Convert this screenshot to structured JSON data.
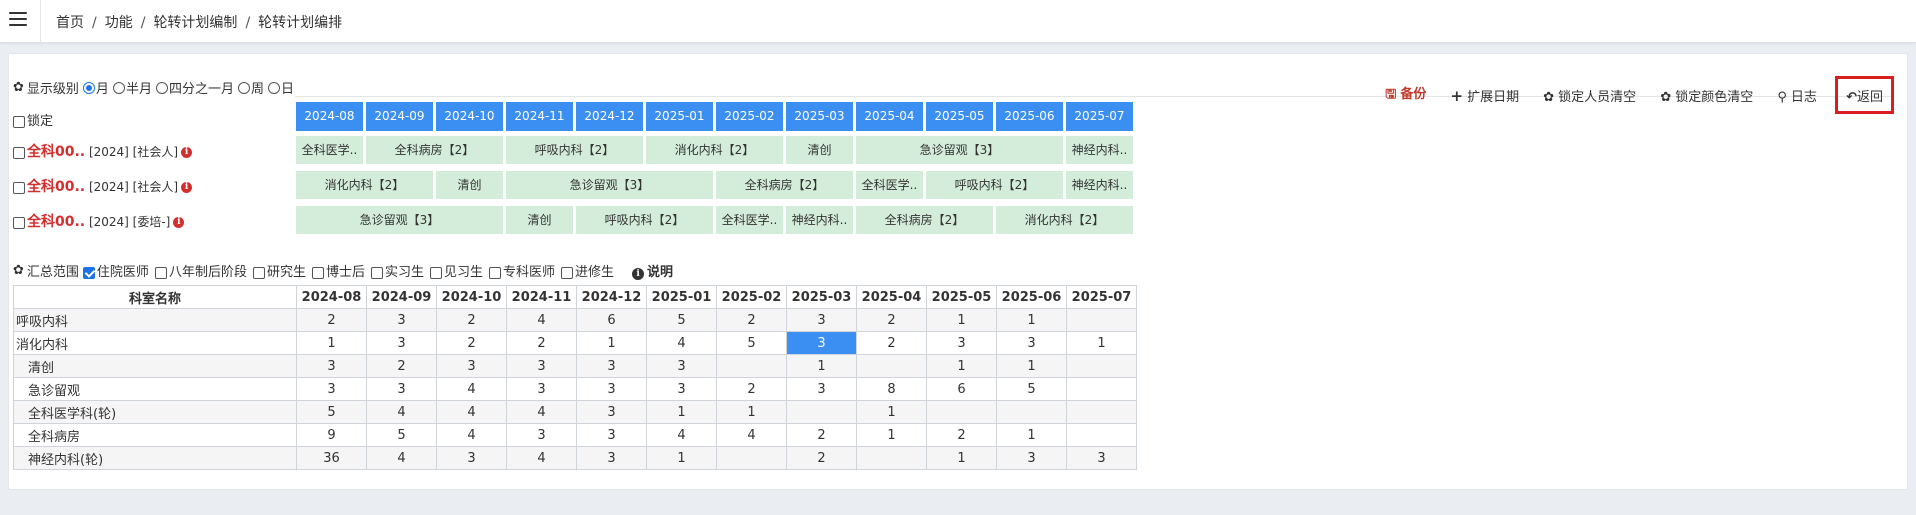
{
  "breadcrumb": [
    "首页",
    "功能",
    "轮转计划编制",
    "轮转计划编排"
  ],
  "display": {
    "label": "显示级别",
    "options": [
      {
        "label": "月",
        "checked": true
      },
      {
        "label": "半月",
        "checked": false
      },
      {
        "label": "四分之一月",
        "checked": false
      },
      {
        "label": "周",
        "checked": false
      },
      {
        "label": "日",
        "checked": false
      }
    ]
  },
  "actions": {
    "backup": "备份",
    "extend": "扩展日期",
    "clear_lock": "锁定人员清空",
    "clear_color": "锁定颜色清空",
    "log": "日志",
    "back": "返回"
  },
  "lock_label": "锁定",
  "months": [
    "2024-08",
    "2024-09",
    "2024-10",
    "2024-11",
    "2024-12",
    "2025-01",
    "2025-02",
    "2025-03",
    "2025-04",
    "2025-05",
    "2025-06",
    "2025-07"
  ],
  "people": [
    {
      "name": "全科00..",
      "year": "[2024]",
      "type": "[社会人]",
      "cells": [
        {
          "label": "全科医学..",
          "span": 1
        },
        {
          "label": "全科病房【2】",
          "span": 2
        },
        {
          "label": "呼吸内科【2】",
          "span": 2
        },
        {
          "label": "消化内科【2】",
          "span": 2
        },
        {
          "label": "清创",
          "span": 1
        },
        {
          "label": "急诊留观【3】",
          "span": 3
        },
        {
          "label": "神经内科..",
          "span": 1
        }
      ]
    },
    {
      "name": "全科00..",
      "year": "[2024]",
      "type": "[社会人]",
      "cells": [
        {
          "label": "消化内科【2】",
          "span": 2
        },
        {
          "label": "清创",
          "span": 1
        },
        {
          "label": "急诊留观【3】",
          "span": 3
        },
        {
          "label": "全科病房【2】",
          "span": 2
        },
        {
          "label": "全科医学..",
          "span": 1
        },
        {
          "label": "呼吸内科【2】",
          "span": 2
        },
        {
          "label": "神经内科..",
          "span": 1
        }
      ]
    },
    {
      "name": "全科00..",
      "year": "[2024]",
      "type": "[委培-]",
      "cells": [
        {
          "label": "急诊留观【3】",
          "span": 3
        },
        {
          "label": "清创",
          "span": 1
        },
        {
          "label": "呼吸内科【2】",
          "span": 2
        },
        {
          "label": "全科医学..",
          "span": 1
        },
        {
          "label": "神经内科..",
          "span": 1
        },
        {
          "label": "全科病房【2】",
          "span": 2
        },
        {
          "label": "消化内科【2】",
          "span": 2
        }
      ]
    }
  ],
  "summary": {
    "label": "汇总范围",
    "options": [
      {
        "label": "住院医师",
        "checked": true
      },
      {
        "label": "八年制后阶段",
        "checked": false
      },
      {
        "label": "研究生",
        "checked": false
      },
      {
        "label": "博士后",
        "checked": false
      },
      {
        "label": "实习生",
        "checked": false
      },
      {
        "label": "见习生",
        "checked": false
      },
      {
        "label": "专科医师",
        "checked": false
      },
      {
        "label": "进修生",
        "checked": false
      }
    ],
    "explain": "说明"
  },
  "table": {
    "header": "科室名称",
    "rows": [
      {
        "name": "呼吸内科",
        "sub": false,
        "values": [
          "2",
          "3",
          "2",
          "4",
          "6",
          "5",
          "2",
          "3",
          "2",
          "1",
          "1",
          ""
        ]
      },
      {
        "name": "消化内科",
        "sub": false,
        "values": [
          "1",
          "3",
          "2",
          "2",
          "1",
          "4",
          "5",
          "3",
          "2",
          "3",
          "3",
          "1"
        ]
      },
      {
        "name": "清创",
        "sub": true,
        "values": [
          "3",
          "2",
          "3",
          "3",
          "3",
          "3",
          "",
          "1",
          "",
          "1",
          "1",
          ""
        ]
      },
      {
        "name": "急诊留观",
        "sub": true,
        "values": [
          "3",
          "3",
          "4",
          "3",
          "3",
          "3",
          "2",
          "3",
          "8",
          "6",
          "5",
          ""
        ]
      },
      {
        "name": "全科医学科(轮)",
        "sub": true,
        "values": [
          "5",
          "4",
          "4",
          "4",
          "3",
          "1",
          "1",
          "",
          "1",
          "",
          "",
          ""
        ]
      },
      {
        "name": "全科病房",
        "sub": true,
        "values": [
          "9",
          "5",
          "4",
          "3",
          "3",
          "4",
          "4",
          "2",
          "1",
          "2",
          "1",
          ""
        ]
      },
      {
        "name": "神经内科(轮)",
        "sub": true,
        "values": [
          "36",
          "4",
          "3",
          "4",
          "3",
          "1",
          "",
          "2",
          "",
          "1",
          "3",
          "3"
        ]
      }
    ]
  }
}
